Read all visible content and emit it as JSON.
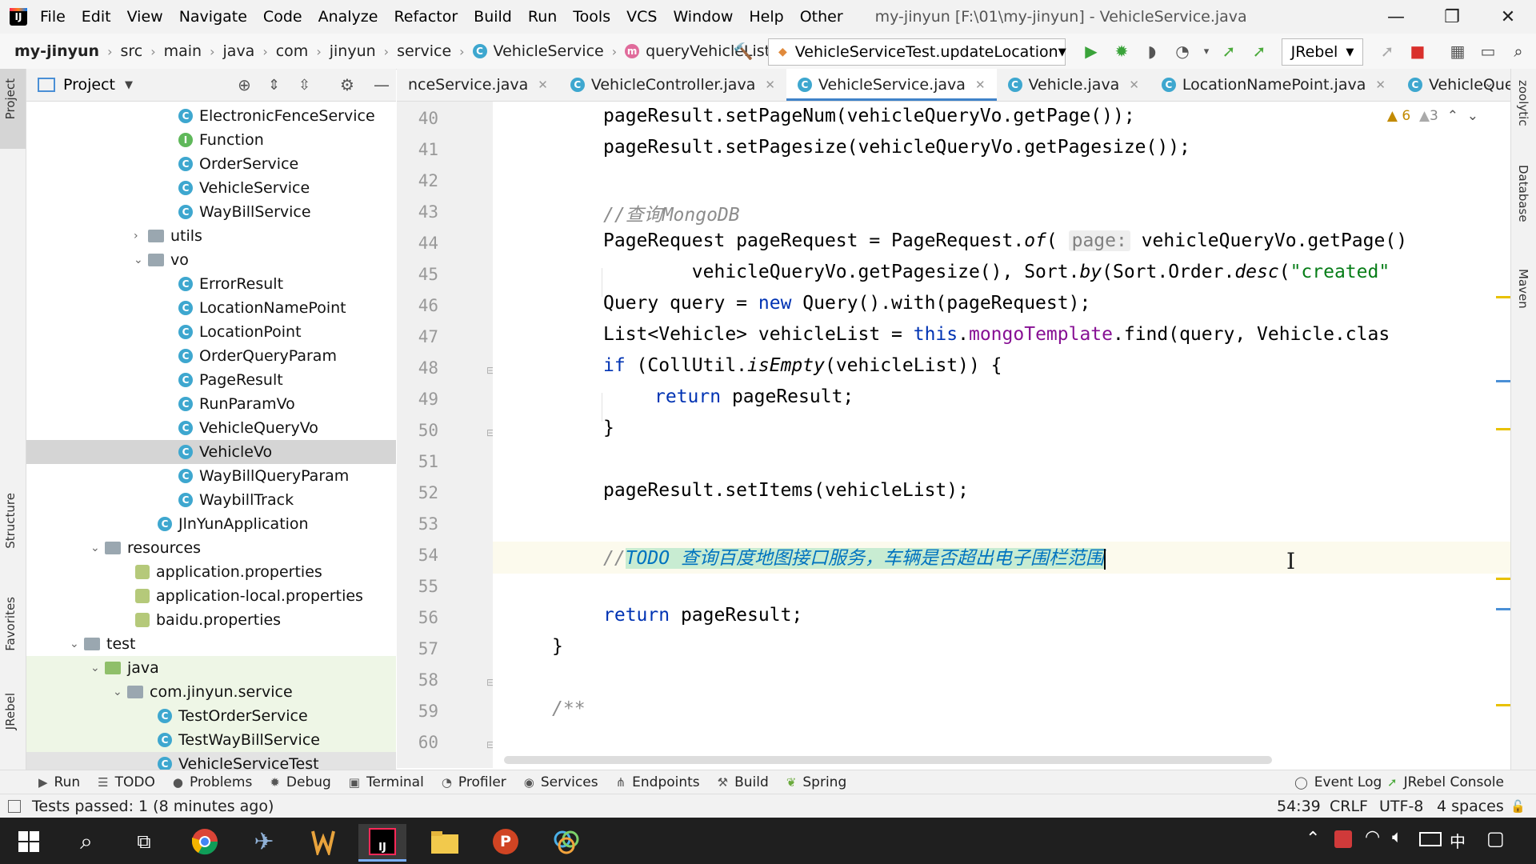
{
  "menu": {
    "items": [
      "File",
      "Edit",
      "View",
      "Navigate",
      "Code",
      "Analyze",
      "Refactor",
      "Build",
      "Run",
      "Tools",
      "VCS",
      "Window",
      "Help",
      "Other"
    ],
    "title": "my-jinyun [F:\\01\\my-jinyun] - VehicleService.java"
  },
  "nav": {
    "crumbs": [
      "my-jinyun",
      "src",
      "main",
      "java",
      "com",
      "jinyun",
      "service",
      "VehicleService",
      "queryVehicleList"
    ],
    "run_config": "VehicleServiceTest.updateLocation",
    "jrebel": "JRebel"
  },
  "left_stripe": {
    "project": "Project",
    "structure": "Structure",
    "favorites": "Favorites",
    "jrebel": "JRebel"
  },
  "right_stripe": {
    "zoolytic": "zoolytic",
    "database": "Database",
    "maven": "Maven"
  },
  "project": {
    "header": "Project",
    "tree": [
      {
        "label": "ElectronicFenceService",
        "kind": "class"
      },
      {
        "label": "Function",
        "kind": "interface"
      },
      {
        "label": "OrderService",
        "kind": "class"
      },
      {
        "label": "VehicleService",
        "kind": "class"
      },
      {
        "label": "WayBillService",
        "kind": "class"
      },
      {
        "label": "utils",
        "kind": "folder"
      },
      {
        "label": "vo",
        "kind": "folder"
      },
      {
        "label": "ErrorResult",
        "kind": "class"
      },
      {
        "label": "LocationNamePoint",
        "kind": "class"
      },
      {
        "label": "LocationPoint",
        "kind": "class"
      },
      {
        "label": "OrderQueryParam",
        "kind": "class"
      },
      {
        "label": "PageResult",
        "kind": "class"
      },
      {
        "label": "RunParamVo",
        "kind": "class"
      },
      {
        "label": "VehicleQueryVo",
        "kind": "class"
      },
      {
        "label": "VehicleVo",
        "kind": "class"
      },
      {
        "label": "WayBillQueryParam",
        "kind": "class"
      },
      {
        "label": "WaybillTrack",
        "kind": "class"
      },
      {
        "label": "JlnYunApplication",
        "kind": "class"
      },
      {
        "label": "resources",
        "kind": "folder"
      },
      {
        "label": "application.properties",
        "kind": "prop"
      },
      {
        "label": "application-local.properties",
        "kind": "prop"
      },
      {
        "label": "baidu.properties",
        "kind": "prop"
      },
      {
        "label": "test",
        "kind": "folder"
      },
      {
        "label": "java",
        "kind": "folder"
      },
      {
        "label": "com.jinyun.service",
        "kind": "folder"
      },
      {
        "label": "TestOrderService",
        "kind": "class"
      },
      {
        "label": "TestWayBillService",
        "kind": "class"
      },
      {
        "label": "VehicleServiceTest",
        "kind": "class"
      }
    ]
  },
  "tabs": [
    "nceService.java",
    "VehicleController.java",
    "VehicleService.java",
    "Vehicle.java",
    "LocationNamePoint.java",
    "VehicleQueryVo.java"
  ],
  "editor": {
    "warnings": "6",
    "weak_warnings": "3",
    "line_numbers": [
      "40",
      "41",
      "42",
      "43",
      "44",
      "45",
      "46",
      "47",
      "48",
      "49",
      "50",
      "51",
      "52",
      "53",
      "54",
      "55",
      "56",
      "57",
      "58",
      "59",
      "60"
    ],
    "code": {
      "l40": "pageResult.setPageNum(vehicleQueryVo.getPage());",
      "l41": "pageResult.setPagesize(vehicleQueryVo.getPagesize());",
      "l43": "//查询MongoDB",
      "l44a": "PageRequest pageRequest = PageRequest.",
      "l44b": "of",
      "l44c": "( ",
      "l44hint": "page:",
      "l44d": " vehicleQueryVo.getPage()",
      "l45a": "        vehicleQueryVo.getPagesize(), Sort.",
      "l45b": "by",
      "l45c": "(Sort.Order.",
      "l45d": "desc",
      "l45e": "(",
      "l45f": "\"created\"",
      "l46a": "Query query = ",
      "l46b": "new",
      "l46c": " Query().with(pageRequest);",
      "l47a": "List<Vehicle> vehicleList = ",
      "l47b": "this",
      "l47c": ".",
      "l47d": "mongoTemplate",
      "l47e": ".find(query, Vehicle.clas",
      "l48a": "if",
      "l48b": " (CollUtil.",
      "l48c": "isEmpty",
      "l48d": "(vehicleList)) {",
      "l49a": "return",
      "l49b": " pageResult;",
      "l50": "}",
      "l52": "pageResult.setItems(vehicleList);",
      "l54a": "//",
      "l54b": "TODO 查询百度地图接口服务，车辆是否超出电子围栏范围",
      "l57a": "return",
      "l57b": " pageResult;",
      "l58": "}",
      "l60": "/**"
    }
  },
  "toolwindows": [
    "Run",
    "TODO",
    "Problems",
    "Debug",
    "Terminal",
    "Profiler",
    "Services",
    "Endpoints",
    "Build",
    "Spring"
  ],
  "toolwindows_right": [
    "Event Log",
    "JRebel Console"
  ],
  "status": {
    "message": "Tests passed: 1 (8 minutes ago)",
    "position": "54:39",
    "line_sep": "CRLF",
    "encoding": "UTF-8",
    "indent": "4 spaces"
  },
  "taskbar": {
    "ime": "中"
  }
}
